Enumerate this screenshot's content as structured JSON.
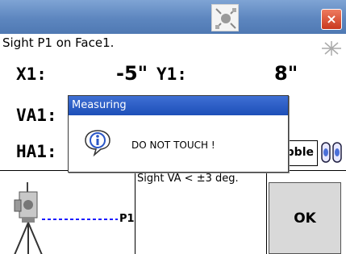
{
  "titlebar": {
    "icon": "satellite-icon",
    "close_label": "×"
  },
  "instruction": "Sight P1 on Face1.",
  "coords": {
    "x1_label": "X1:",
    "x1_value": "-5\"",
    "y1_label": "Y1:",
    "y1_value": "8\""
  },
  "angles": {
    "va1_label": "VA1:",
    "ha1_label": "HA1:"
  },
  "bubble_button_label": "bble",
  "diagram": {
    "target_label": "P1"
  },
  "sight_note": "Sight VA < ±3 deg.",
  "ok_label": "OK",
  "dialog": {
    "title": "Measuring",
    "icon": "info-icon",
    "message": "DO NOT TOUCH !"
  },
  "colors": {
    "titlebar": "#5d86bf",
    "dialog_title": "#1d4fb8",
    "dashed_line": "#1a1aff"
  }
}
